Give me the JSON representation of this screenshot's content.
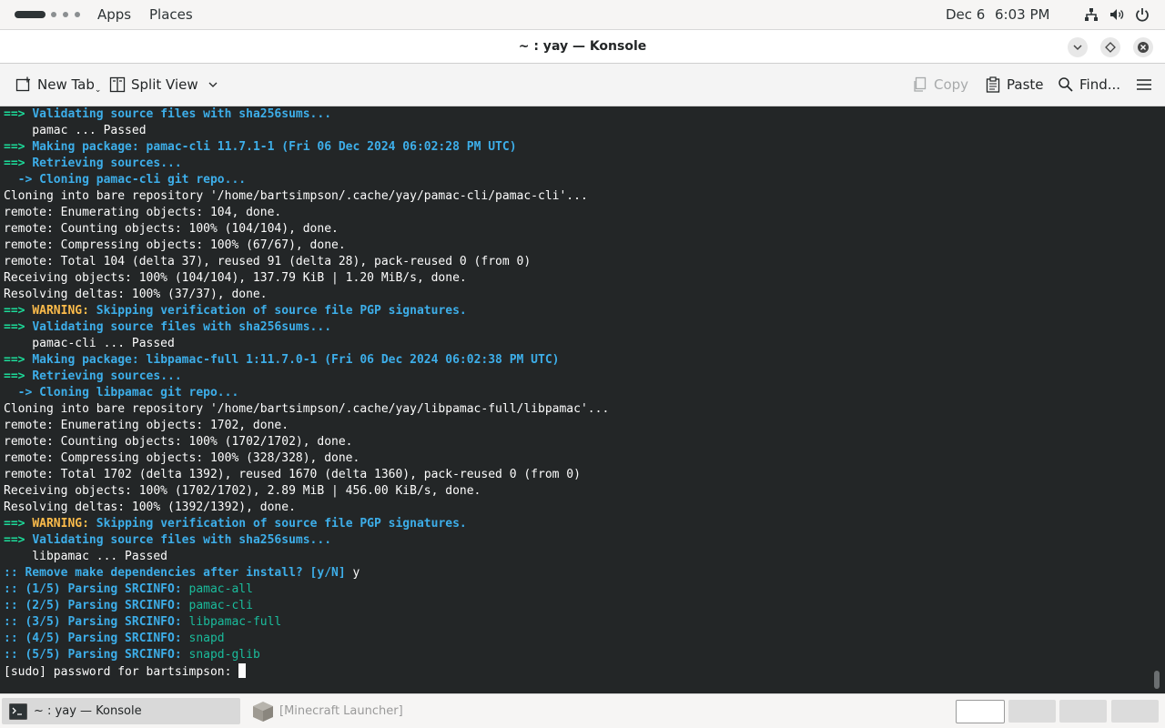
{
  "topbar": {
    "apps_label": "Apps",
    "places_label": "Places",
    "date": "Dec 6",
    "time": "6:03 PM"
  },
  "window": {
    "title": "~ : yay — Konsole"
  },
  "toolbar": {
    "new_tab": "New Tab",
    "split_view": "Split View",
    "copy": "Copy",
    "paste": "Paste",
    "find": "Find..."
  },
  "terminal": {
    "lines": [
      {
        "segs": [
          {
            "t": "==> ",
            "c": "arrow"
          },
          {
            "t": "Validating source files with sha256sums...",
            "c": "msg"
          }
        ]
      },
      {
        "segs": [
          {
            "t": "    pamac ... Passed",
            "c": "plain"
          }
        ]
      },
      {
        "segs": [
          {
            "t": "==> ",
            "c": "arrow"
          },
          {
            "t": "Making package: pamac-cli 11.7.1-1 (Fri 06 Dec 2024 06:02:28 PM UTC)",
            "c": "msg"
          }
        ]
      },
      {
        "segs": [
          {
            "t": "==> ",
            "c": "arrow"
          },
          {
            "t": "Retrieving sources...",
            "c": "msg"
          }
        ]
      },
      {
        "segs": [
          {
            "t": "  -> Cloning pamac-cli git repo...",
            "c": "sub"
          }
        ]
      },
      {
        "segs": [
          {
            "t": "Cloning into bare repository '/home/bartsimpson/.cache/yay/pamac-cli/pamac-cli'...",
            "c": "plain"
          }
        ]
      },
      {
        "segs": [
          {
            "t": "remote: Enumerating objects: 104, done.",
            "c": "plain"
          }
        ]
      },
      {
        "segs": [
          {
            "t": "remote: Counting objects: 100% (104/104), done.",
            "c": "plain"
          }
        ]
      },
      {
        "segs": [
          {
            "t": "remote: Compressing objects: 100% (67/67), done.",
            "c": "plain"
          }
        ]
      },
      {
        "segs": [
          {
            "t": "remote: Total 104 (delta 37), reused 91 (delta 28), pack-reused 0 (from 0)",
            "c": "plain"
          }
        ]
      },
      {
        "segs": [
          {
            "t": "Receiving objects: 100% (104/104), 137.79 KiB | 1.20 MiB/s, done.",
            "c": "plain"
          }
        ]
      },
      {
        "segs": [
          {
            "t": "Resolving deltas: 100% (37/37), done.",
            "c": "plain"
          }
        ]
      },
      {
        "segs": [
          {
            "t": "==> ",
            "c": "arrow"
          },
          {
            "t": "WARNING: ",
            "c": "warn"
          },
          {
            "t": "Skipping verification of source file PGP signatures.",
            "c": "msg"
          }
        ]
      },
      {
        "segs": [
          {
            "t": "==> ",
            "c": "arrow"
          },
          {
            "t": "Validating source files with sha256sums...",
            "c": "msg"
          }
        ]
      },
      {
        "segs": [
          {
            "t": "    pamac-cli ... Passed",
            "c": "plain"
          }
        ]
      },
      {
        "segs": [
          {
            "t": "==> ",
            "c": "arrow"
          },
          {
            "t": "Making package: libpamac-full 1:11.7.0-1 (Fri 06 Dec 2024 06:02:38 PM UTC)",
            "c": "msg"
          }
        ]
      },
      {
        "segs": [
          {
            "t": "==> ",
            "c": "arrow"
          },
          {
            "t": "Retrieving sources...",
            "c": "msg"
          }
        ]
      },
      {
        "segs": [
          {
            "t": "  -> Cloning libpamac git repo...",
            "c": "sub"
          }
        ]
      },
      {
        "segs": [
          {
            "t": "Cloning into bare repository '/home/bartsimpson/.cache/yay/libpamac-full/libpamac'...",
            "c": "plain"
          }
        ]
      },
      {
        "segs": [
          {
            "t": "remote: Enumerating objects: 1702, done.",
            "c": "plain"
          }
        ]
      },
      {
        "segs": [
          {
            "t": "remote: Counting objects: 100% (1702/1702), done.",
            "c": "plain"
          }
        ]
      },
      {
        "segs": [
          {
            "t": "remote: Compressing objects: 100% (328/328), done.",
            "c": "plain"
          }
        ]
      },
      {
        "segs": [
          {
            "t": "remote: Total 1702 (delta 1392), reused 1670 (delta 1360), pack-reused 0 (from 0)",
            "c": "plain"
          }
        ]
      },
      {
        "segs": [
          {
            "t": "Receiving objects: 100% (1702/1702), 2.89 MiB | 456.00 KiB/s, done.",
            "c": "plain"
          }
        ]
      },
      {
        "segs": [
          {
            "t": "Resolving deltas: 100% (1392/1392), done.",
            "c": "plain"
          }
        ]
      },
      {
        "segs": [
          {
            "t": "==> ",
            "c": "arrow"
          },
          {
            "t": "WARNING: ",
            "c": "warn"
          },
          {
            "t": "Skipping verification of source file PGP signatures.",
            "c": "msg"
          }
        ]
      },
      {
        "segs": [
          {
            "t": "==> ",
            "c": "arrow"
          },
          {
            "t": "Validating source files with sha256sums...",
            "c": "msg"
          }
        ]
      },
      {
        "segs": [
          {
            "t": "    libpamac ... Passed",
            "c": "plain"
          }
        ]
      },
      {
        "segs": [
          {
            "t": ":: Remove make dependencies after install? [y/N] ",
            "c": "msg"
          },
          {
            "t": "y",
            "c": "plain"
          }
        ]
      },
      {
        "segs": [
          {
            "t": ":: (1/5) Parsing SRCINFO: ",
            "c": "msg"
          },
          {
            "t": "pamac-all",
            "c": "pkg"
          }
        ]
      },
      {
        "segs": [
          {
            "t": ":: (2/5) Parsing SRCINFO: ",
            "c": "msg"
          },
          {
            "t": "pamac-cli",
            "c": "pkg"
          }
        ]
      },
      {
        "segs": [
          {
            "t": ":: (3/5) Parsing SRCINFO: ",
            "c": "msg"
          },
          {
            "t": "libpamac-full",
            "c": "pkg"
          }
        ]
      },
      {
        "segs": [
          {
            "t": ":: (4/5) Parsing SRCINFO: ",
            "c": "msg"
          },
          {
            "t": "snapd",
            "c": "pkg"
          }
        ]
      },
      {
        "segs": [
          {
            "t": ":: (5/5) Parsing SRCINFO: ",
            "c": "msg"
          },
          {
            "t": "snapd-glib",
            "c": "pkg"
          }
        ]
      },
      {
        "segs": [
          {
            "t": "[sudo] password for bartsimpson: ",
            "c": "plain"
          }
        ],
        "cursor": true
      }
    ]
  },
  "taskbar": {
    "konsole_task": "~ : yay — Konsole",
    "minecraft_task": "[Minecraft Launcher]"
  },
  "colors": {
    "terminal_bg": "#232627",
    "arrow": "#1cdc9a",
    "message": "#3daee9",
    "warning": "#fdbc4b",
    "package": "#1abc9c"
  },
  "icons": [
    "activities-icon",
    "network-icon",
    "volume-icon",
    "power-icon",
    "chevron-down-icon",
    "diamond-icon",
    "close-icon",
    "new-tab-icon",
    "split-view-icon",
    "copy-icon",
    "paste-icon",
    "search-icon",
    "hamburger-menu-icon",
    "terminal-icon",
    "minecraft-icon"
  ]
}
